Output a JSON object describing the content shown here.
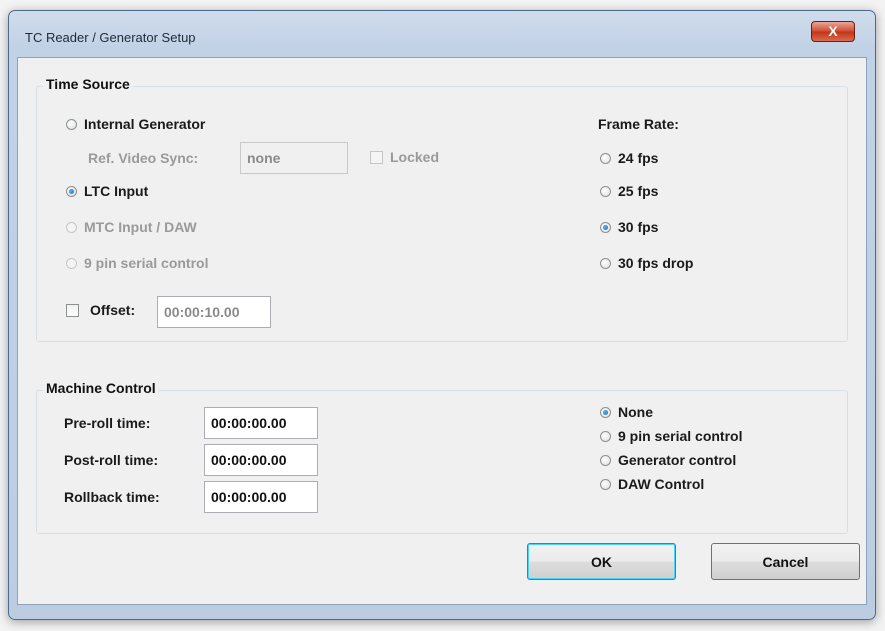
{
  "window": {
    "title": "TC Reader / Generator Setup",
    "close_label": "X"
  },
  "time_source": {
    "legend": "Time Source",
    "internal_generator": "Internal Generator",
    "ref_video_sync_label": "Ref. Video Sync:",
    "ref_video_sync_value": "none",
    "locked_label": "Locked",
    "ltc_input": "LTC Input",
    "mtc_input": "MTC Input / DAW",
    "nine_pin": "9 pin serial control",
    "offset_label": "Offset:",
    "offset_value": "00:00:10.00",
    "selected": "LTC Input",
    "frame_rate": {
      "label": "Frame Rate:",
      "options": [
        "24 fps",
        "25 fps",
        "30 fps",
        "30 fps drop"
      ],
      "selected": "30 fps"
    }
  },
  "machine_control": {
    "legend": "Machine Control",
    "preroll_label": "Pre-roll time:",
    "preroll_value": "00:00:00.00",
    "postroll_label": "Post-roll time:",
    "postroll_value": "00:00:00.00",
    "rollback_label": "Rollback time:",
    "rollback_value": "00:00:00.00",
    "options": [
      "None",
      "9 pin serial control",
      "Generator control",
      "DAW Control"
    ],
    "selected": "None"
  },
  "buttons": {
    "ok": "OK",
    "cancel": "Cancel"
  }
}
